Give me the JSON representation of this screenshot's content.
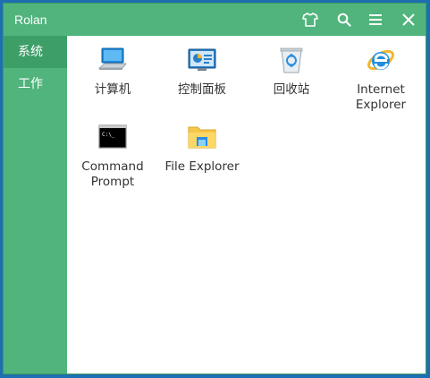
{
  "window": {
    "title": "Rolan",
    "accent": "#50b47c",
    "accent_active": "#3d9e68",
    "desktop_bg": "#1c6fb0"
  },
  "titlebar_buttons": [
    {
      "icon": "shirt-icon",
      "name": "skin-button"
    },
    {
      "icon": "search-icon",
      "name": "search-button"
    },
    {
      "icon": "menu-icon",
      "name": "menu-button"
    },
    {
      "icon": "close-icon",
      "name": "close-button"
    }
  ],
  "sidebar": {
    "items": [
      {
        "label": "系统",
        "active": true
      },
      {
        "label": "工作",
        "active": false
      }
    ]
  },
  "apps": [
    {
      "label": "计算机",
      "icon": "computer-icon"
    },
    {
      "label": "控制面板",
      "icon": "control-panel-icon"
    },
    {
      "label": "回收站",
      "icon": "recycle-bin-icon"
    },
    {
      "label": "Internet\nExplorer",
      "icon": "internet-explorer-icon"
    },
    {
      "label": "Command\nPrompt",
      "icon": "command-prompt-icon"
    },
    {
      "label": "File Explorer",
      "icon": "file-explorer-icon"
    }
  ]
}
